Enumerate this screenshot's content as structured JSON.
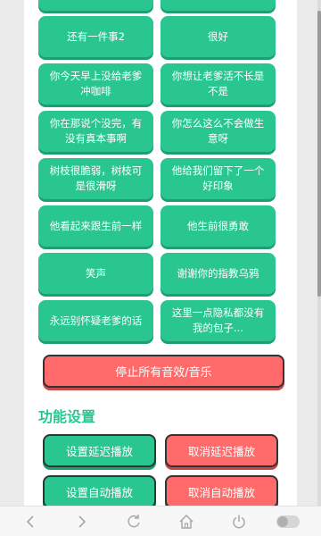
{
  "sound_buttons": [
    {
      "label": ""
    },
    {
      "label": ""
    },
    {
      "label": "还有一件事2"
    },
    {
      "label": "很好"
    },
    {
      "label": "你今天早上没给老爹冲咖啡"
    },
    {
      "label": "你想让老爹活不长是不是"
    },
    {
      "label": "你在那说个没完，有没有真本事啊"
    },
    {
      "label": "你怎么这么不会做生意呀"
    },
    {
      "label": "树枝很脆弱，树枝可是很滑呀"
    },
    {
      "label": "他给我们留下了一个好印象"
    },
    {
      "label": "他看起来跟生前一样"
    },
    {
      "label": "他生前很勇敢"
    },
    {
      "label": "笑声"
    },
    {
      "label": "谢谢你的指教乌鸦"
    },
    {
      "label": "永远别怀疑老爹的话"
    },
    {
      "label": "这里一点隐私都没有我的包子..."
    }
  ],
  "stop_all": {
    "label": "停止所有音效/音乐"
  },
  "section": {
    "title": "功能设置"
  },
  "functions": {
    "set_delay": "设置延迟播放",
    "cancel_delay": "取消延迟播放",
    "set_auto": "设置自动播放",
    "cancel_auto": "取消自动播放"
  },
  "nav": {
    "back_icon": "chevron-left-icon",
    "forward_icon": "chevron-right-icon",
    "refresh_icon": "refresh-icon",
    "home_icon": "home-icon",
    "power_icon": "power-icon",
    "toggle_icon": "toggle-icon"
  },
  "colors": {
    "accent": "#29c690",
    "danger": "#ff6b6b"
  }
}
